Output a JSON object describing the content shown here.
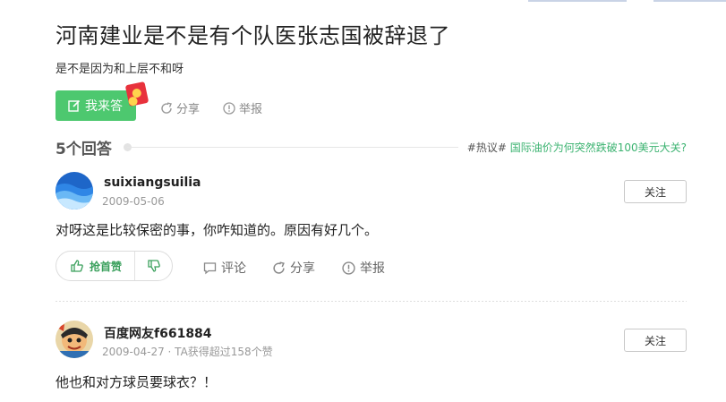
{
  "question": {
    "title": "河南建业是不是有个队医张志国被辞退了",
    "description": "是不是因为和上层不和呀"
  },
  "actions": {
    "answer_label": "我来答",
    "share_label": "分享",
    "report_label": "举报"
  },
  "answers_header": {
    "count_label": "5个回答",
    "hot_tag": "#热议#",
    "hot_link": "国际油价为何突然跌破100美元大关?"
  },
  "answers": [
    {
      "username": "suixiangsuilia",
      "meta": "2009-05-06",
      "follow_label": "关注",
      "content": "对呀这是比较保密的事，你咋知道的。原因有好几个。",
      "upvote_label": "抢首赞",
      "comment_label": "评论",
      "share_label": "分享",
      "report_label": "举报"
    },
    {
      "username": "百度网友f661884",
      "meta": "2009-04-27 · TA获得超过158个赞",
      "follow_label": "关注",
      "content": "他也和对方球员要球衣？！"
    }
  ],
  "colors": {
    "brand_green": "#4dc86f",
    "link_green": "#3cb371"
  }
}
